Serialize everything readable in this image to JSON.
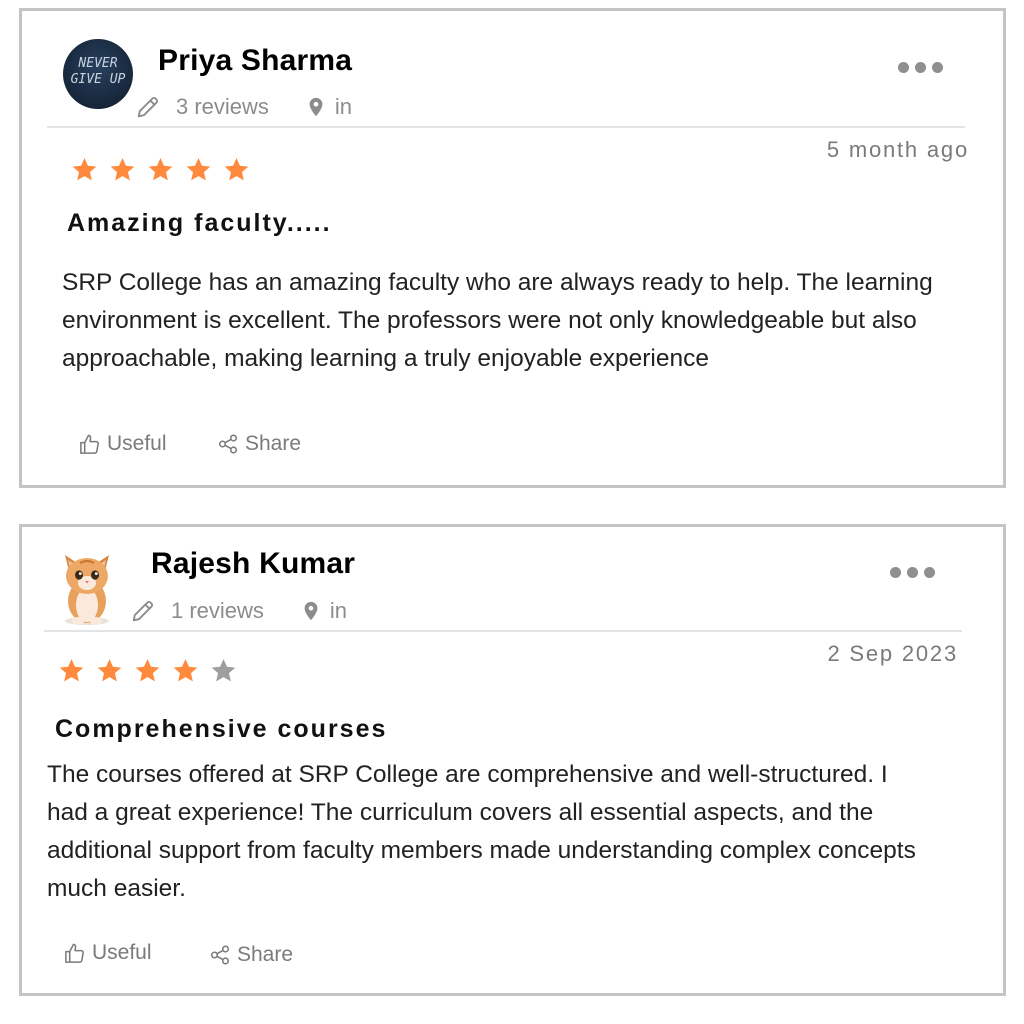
{
  "colors": {
    "star_filled": "#ff8a3d",
    "star_empty": "#9e9e9e",
    "muted_text": "#8c8c8c",
    "card_border": "#c4c4c4"
  },
  "reviews": [
    {
      "avatar": {
        "type": "text-image",
        "line1": "NEVER",
        "line2": "GIVE UP"
      },
      "author": "Priya Sharma",
      "reviews_count": "3 reviews",
      "location": "in",
      "date": "5 month ago",
      "rating": 5,
      "title": "Amazing faculty.....",
      "body": "SRP College has an amazing faculty who are always ready to help. The learning environment is excellent. The professors were not only knowledgeable but also approachable, making learning a truly enjoyable experience",
      "useful_label": "Useful",
      "share_label": "Share"
    },
    {
      "avatar": {
        "type": "kitten-image"
      },
      "author": "Rajesh Kumar",
      "reviews_count": "1 reviews",
      "location": "in",
      "date": "2 Sep 2023",
      "rating": 4,
      "title": "Comprehensive courses",
      "body": "The courses offered at SRP College are comprehensive and well-structured. I had a great experience! The curriculum covers all essential aspects, and the additional support from faculty members made understanding complex concepts much easier.",
      "useful_label": "Useful",
      "share_label": "Share"
    }
  ]
}
